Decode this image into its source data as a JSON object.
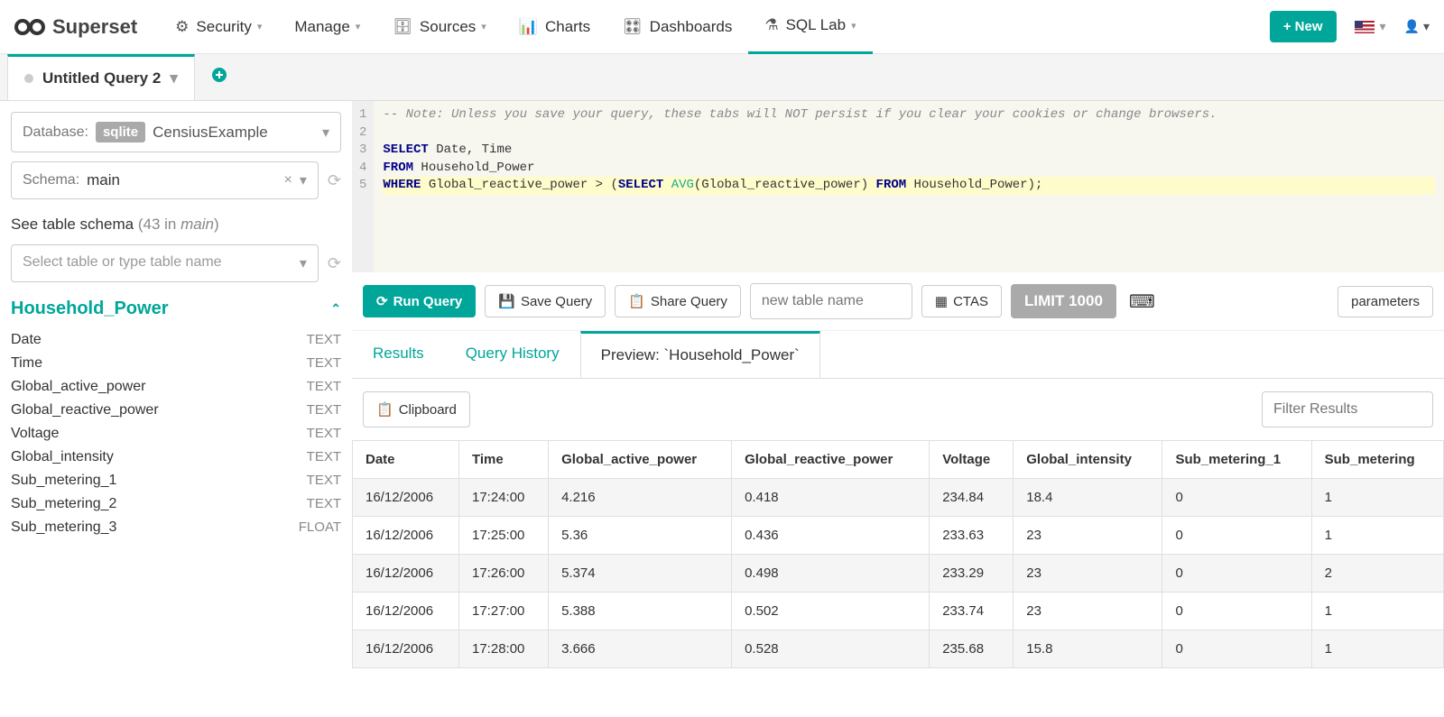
{
  "brand": "Superset",
  "nav": {
    "security": "Security",
    "manage": "Manage",
    "sources": "Sources",
    "charts": "Charts",
    "dashboards": "Dashboards",
    "sqllab": "SQL Lab"
  },
  "new_btn": "New",
  "query_tab": "Untitled Query 2",
  "db_label": "Database:",
  "db_engine": "sqlite",
  "db_name": "CensiusExample",
  "schema_label": "Schema:",
  "schema_value": "main",
  "see_schema": "See table schema",
  "schema_count": "(43 in ",
  "schema_name_italic": "main",
  "schema_count_close": ")",
  "table_select_placeholder": "Select table or type table name",
  "table_name": "Household_Power",
  "columns": [
    {
      "name": "Date",
      "type": "TEXT"
    },
    {
      "name": "Time",
      "type": "TEXT"
    },
    {
      "name": "Global_active_power",
      "type": "TEXT"
    },
    {
      "name": "Global_reactive_power",
      "type": "TEXT"
    },
    {
      "name": "Voltage",
      "type": "TEXT"
    },
    {
      "name": "Global_intensity",
      "type": "TEXT"
    },
    {
      "name": "Sub_metering_1",
      "type": "TEXT"
    },
    {
      "name": "Sub_metering_2",
      "type": "TEXT"
    },
    {
      "name": "Sub_metering_3",
      "type": "FLOAT"
    }
  ],
  "sql_comment": "-- Note: Unless you save your query, these tabs will NOT persist if you clear your cookies or change browsers.",
  "sql_l3_select": "SELECT",
  "sql_l3_cols": " Date, Time",
  "sql_l4_from": "FROM",
  "sql_l4_tbl": " Household_Power",
  "sql_l5_where": "WHERE",
  "sql_l5_a": " Global_reactive_power > (",
  "sql_l5_sel": "SELECT",
  "sql_l5_sp": " ",
  "sql_l5_avg": "AVG",
  "sql_l5_b": "(Global_reactive_power) ",
  "sql_l5_from": "FROM",
  "sql_l5_c": " Household_Power);",
  "run_query": "Run Query",
  "save_query": "Save Query",
  "share_query": "Share Query",
  "new_table_placeholder": "new table name",
  "ctas": "CTAS",
  "limit": "LIMIT 1000",
  "parameters": "parameters",
  "tabs": {
    "results": "Results",
    "history": "Query History",
    "preview": "Preview: `Household_Power`"
  },
  "clipboard": "Clipboard",
  "filter_placeholder": "Filter Results",
  "headers": [
    "Date",
    "Time",
    "Global_active_power",
    "Global_reactive_power",
    "Voltage",
    "Global_intensity",
    "Sub_metering_1",
    "Sub_metering"
  ],
  "rows": [
    [
      "16/12/2006",
      "17:24:00",
      "4.216",
      "0.418",
      "234.84",
      "18.4",
      "0",
      "1"
    ],
    [
      "16/12/2006",
      "17:25:00",
      "5.36",
      "0.436",
      "233.63",
      "23",
      "0",
      "1"
    ],
    [
      "16/12/2006",
      "17:26:00",
      "5.374",
      "0.498",
      "233.29",
      "23",
      "0",
      "2"
    ],
    [
      "16/12/2006",
      "17:27:00",
      "5.388",
      "0.502",
      "233.74",
      "23",
      "0",
      "1"
    ],
    [
      "16/12/2006",
      "17:28:00",
      "3.666",
      "0.528",
      "235.68",
      "15.8",
      "0",
      "1"
    ]
  ]
}
